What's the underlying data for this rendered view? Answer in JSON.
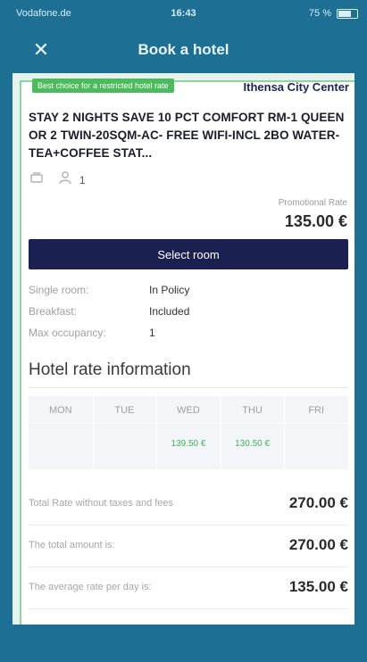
{
  "status_bar": {
    "carrier": "Vodafone.de",
    "time": "16:43",
    "battery": "75 %"
  },
  "nav": {
    "title": "Book a hotel",
    "close_label": "✕"
  },
  "hotel": {
    "name_peek": "Ithensa City Center"
  },
  "offer": {
    "badge": "Best choice for a restricted hotel rate",
    "room_title": "STAY 2 NIGHTS SAVE 10 PCT COMFORT RM-1 QUEEN OR 2 TWIN-20SQM-AC- FREE WIFI-INCL 2BO WATER-TEA+COFFEE STAT...",
    "occupancy_count": "1",
    "rate_label": "Promotional Rate",
    "price": "135.00 €",
    "select_label": "Select room",
    "details": [
      {
        "key": "Single room:",
        "value": "In Policy"
      },
      {
        "key": "Breakfast:",
        "value": "Included"
      },
      {
        "key": "Max occupancy:",
        "value": "1"
      }
    ]
  },
  "rate_info": {
    "title": "Hotel rate information",
    "days": [
      {
        "name": "MON",
        "amount": ""
      },
      {
        "name": "TUE",
        "amount": ""
      },
      {
        "name": "WED",
        "amount": "139.50 €"
      },
      {
        "name": "THU",
        "amount": "130.50 €"
      },
      {
        "name": "FRI",
        "amount": ""
      }
    ]
  },
  "totals": [
    {
      "label": "Total Rate without taxes and fees",
      "value": "270.00 €"
    },
    {
      "label": "The total amount is:",
      "value": "270.00 €"
    },
    {
      "label": "The average rate per day is:",
      "value": "135.00 €"
    }
  ],
  "colors": {
    "header": "#1d6f94",
    "button": "#1a2050",
    "badge": "#4cbb5e",
    "rate_amount": "#3bb55a"
  }
}
